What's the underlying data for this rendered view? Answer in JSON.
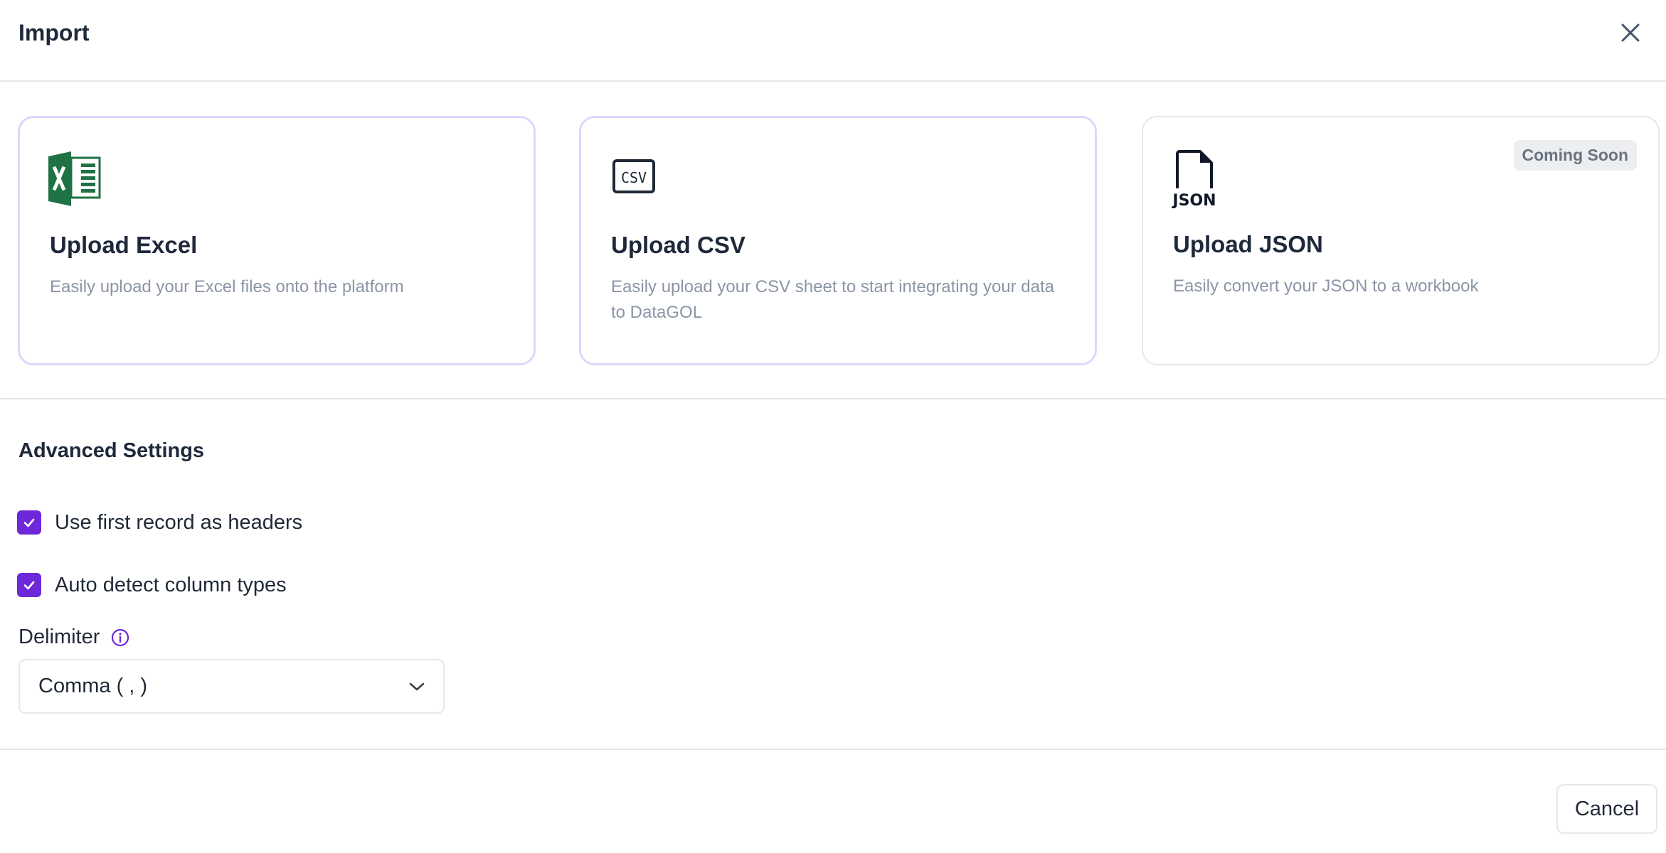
{
  "dialog": {
    "title": "Import",
    "close_icon": "close-icon"
  },
  "options": [
    {
      "title": "Upload Excel",
      "description": "Easily upload your Excel files onto the platform",
      "icon": "excel-icon"
    },
    {
      "title": "Upload CSV",
      "description": "Easily upload your CSV sheet to start integrating your data to DataGOL",
      "icon": "csv-icon",
      "icon_text": "CSV"
    },
    {
      "title": "Upload JSON",
      "description": "Easily convert your JSON to a workbook",
      "icon": "json-file-icon",
      "icon_text": "JSON",
      "badge": "Coming Soon"
    }
  ],
  "advanced": {
    "title": "Advanced Settings",
    "first_record_headers": {
      "label": "Use first record as headers",
      "checked": true
    },
    "auto_detect_types": {
      "label": "Auto detect column types",
      "checked": true
    },
    "delimiter": {
      "label": "Delimiter",
      "info_icon": "info-icon",
      "selected": "Comma ( , )",
      "chevron_icon": "chevron-down-icon"
    }
  },
  "footer": {
    "cancel_label": "Cancel"
  },
  "colors": {
    "accent": "#6d28d9",
    "card_border": "#ddd6fe",
    "excel_green": "#1f7244",
    "muted_text": "#8b95a5"
  }
}
